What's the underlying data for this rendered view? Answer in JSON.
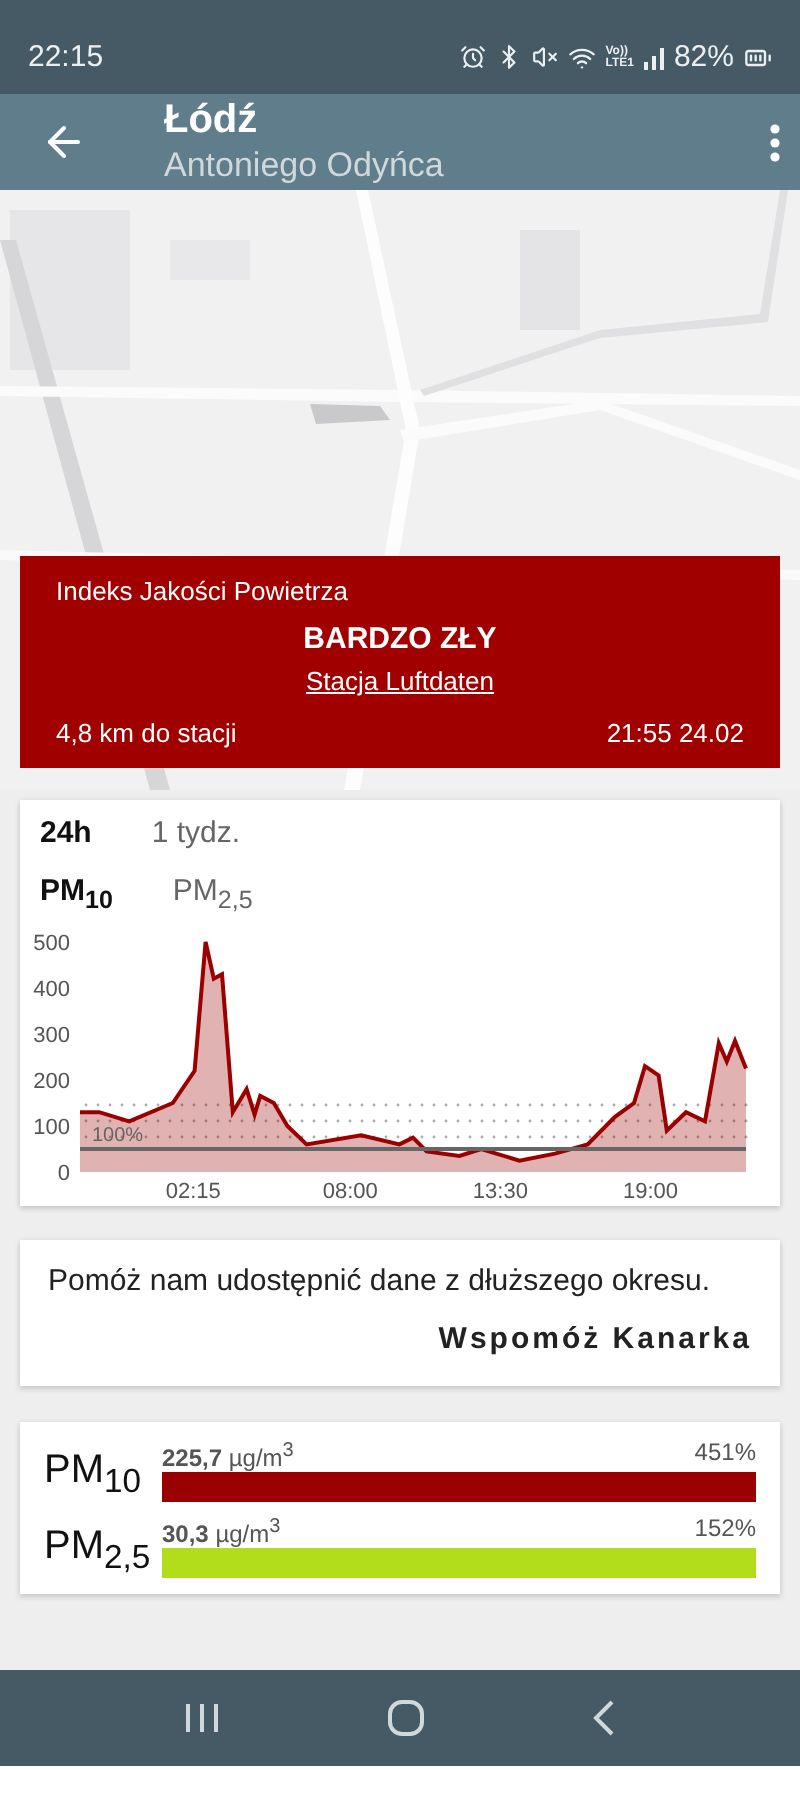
{
  "status_bar": {
    "time": "22:15",
    "network_labels": [
      "Vo))",
      "LTE1"
    ],
    "battery": "82%"
  },
  "app_bar": {
    "title": "Łódź",
    "subtitle": "Antoniego Odyńca"
  },
  "index_card": {
    "title": "Indeks Jakości Powietrza",
    "rating": "BARDZO ZŁY",
    "station_link": "Stacja Luftdaten",
    "distance": "4,8 km do stacji",
    "updated": "21:55 24.02"
  },
  "chart_card": {
    "periods": [
      {
        "label": "24h",
        "selected": true
      },
      {
        "label": "1 tydz.",
        "selected": false
      }
    ],
    "pollutants": [
      {
        "label": "PM$_{10}$",
        "selected": true
      },
      {
        "label": "PM$_{2,5}$",
        "selected": false
      }
    ],
    "chart_data": {
      "type": "area",
      "x": [
        -1.9,
        -1.2,
        -0.1,
        1.5,
        2.3,
        2.7,
        3.0,
        3.3,
        3.7,
        4.2,
        4.5,
        4.7,
        5.2,
        5.7,
        6.4,
        8.4,
        9.8,
        10.3,
        10.8,
        12.0,
        12.8,
        14.2,
        15.5,
        16.7,
        17.7,
        18.4,
        18.8,
        19.3,
        19.6,
        20.3,
        21.0,
        21.5,
        21.8,
        22.1,
        22.5
      ],
      "series": [
        {
          "color": "#9b0000",
          "values": [
            130,
            130,
            110,
            150,
            220,
            500,
            420,
            430,
            130,
            180,
            125,
            165,
            150,
            100,
            60,
            80,
            60,
            75,
            45,
            35,
            50,
            25,
            40,
            60,
            120,
            150,
            230,
            210,
            90,
            130,
            110,
            280,
            240,
            285,
            225
          ]
        }
      ],
      "xlim": [
        -1.9,
        22.5
      ],
      "ylim": [
        0,
        500
      ],
      "xticks": [
        {
          "value": 2.25,
          "label": "02:15"
        },
        {
          "value": 8,
          "label": "08:00"
        },
        {
          "value": 13.5,
          "label": "13:30"
        },
        {
          "value": 19,
          "label": "19:00"
        }
      ],
      "yticks": [
        0,
        100,
        200,
        300,
        400,
        500
      ],
      "annotations": [
        "100%"
      ]
    }
  },
  "promo": {
    "text": "Pomóż nam udostępnić dane z dłuższego okresu.",
    "button": "Wspomóż Kanarka"
  },
  "measurements": [
    {
      "label": "PM$_{10}$",
      "value": "**225,7** µg/m$^{3}$",
      "percent": "451%",
      "color": "#9b0000"
    },
    {
      "label": "PM$_{2,5}$",
      "value": "**30,3** µg/m$^{3}$",
      "percent": "152%",
      "color": "#b2dd1a"
    }
  ],
  "nav_bar": {
    "kind": "android"
  }
}
